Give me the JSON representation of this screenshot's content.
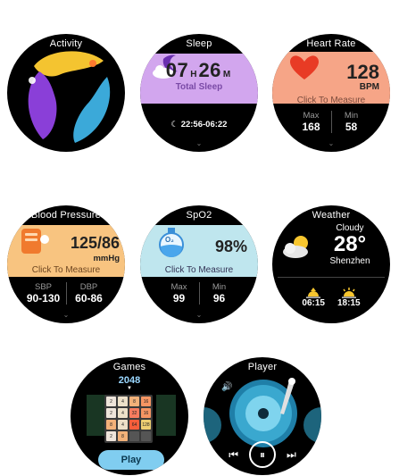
{
  "activity": {
    "title": "Activity"
  },
  "sleep": {
    "title": "Sleep",
    "hours": "07",
    "hours_unit": "H",
    "minutes": "26",
    "minutes_unit": "M",
    "label": "Total Sleep",
    "range": "22:56-06:22"
  },
  "heart_rate": {
    "title": "Heart Rate",
    "value": "128",
    "unit": "BPM",
    "click_label": "Click To Measure",
    "max_label": "Max",
    "max_value": "168",
    "min_label": "Min",
    "min_value": "58"
  },
  "blood_pressure": {
    "title": "Blood Pressure",
    "value": "125/86",
    "unit": "mmHg",
    "click_label": "Click To Measure",
    "sbp_label": "SBP",
    "sbp_range": "90-130",
    "dbp_label": "DBP",
    "dbp_range": "60-86"
  },
  "spo2": {
    "title": "SpO2",
    "value": "98%",
    "flask_label": "O₂",
    "click_label": "Click To Measure",
    "max_label": "Max",
    "max_value": "99",
    "min_label": "Min",
    "min_value": "96"
  },
  "weather": {
    "title": "Weather",
    "condition": "Cloudy",
    "temperature": "28°",
    "city": "Shenzhen",
    "sunrise": "06:15",
    "sunset": "18:15"
  },
  "games": {
    "title": "Games",
    "game_name": "2048",
    "play_label": "Play",
    "cells": [
      "2",
      "4",
      "8",
      "16",
      "2",
      "4",
      "32",
      "16",
      "8",
      "4",
      "64",
      "128",
      "2",
      "8",
      "",
      ""
    ]
  },
  "player": {
    "title": "Player"
  },
  "colors": {
    "sleep_band": "#d2a6ee",
    "heart_band": "#f6a587",
    "bp_band": "#f8c480",
    "spo2_band": "#bfe6ee",
    "play_button": "#80cdf0"
  },
  "icons": {
    "activity": "activity-rings-icon",
    "sleep": "moon-cloud-icon",
    "heart": "heart-icon",
    "bp": "bp-monitor-icon",
    "spo2": "oxygen-flask-icon",
    "weather": "cloudy-sun-icon",
    "player": "vinyl-record-icon"
  }
}
